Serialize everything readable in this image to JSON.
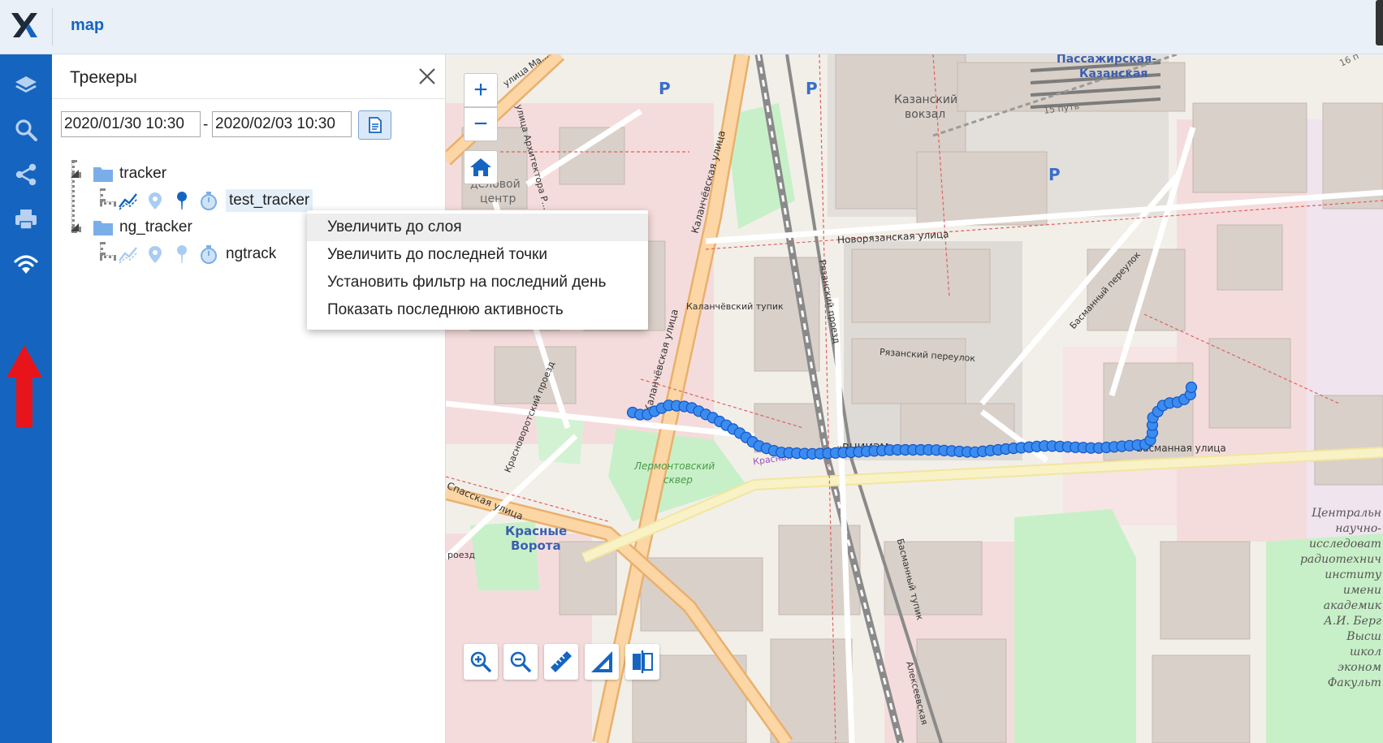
{
  "header": {
    "title": "map",
    "logo": "x-logo-icon"
  },
  "rail": {
    "items": [
      {
        "name": "layers-icon"
      },
      {
        "name": "search-icon"
      },
      {
        "name": "share-icon"
      },
      {
        "name": "print-icon"
      },
      {
        "name": "wifi-icon"
      }
    ],
    "annotation_color": "#e8141b"
  },
  "panel": {
    "title": "Трекеры",
    "date_from": "2020/01/30 10:30",
    "date_sep": "-",
    "date_to": "2020/02/03 10:30",
    "groups": [
      {
        "label": "tracker",
        "trackers": [
          {
            "label": "test_tracker",
            "selected": true
          }
        ]
      },
      {
        "label": "ng_tracker",
        "trackers": [
          {
            "label": "ngtrack",
            "selected": false
          }
        ]
      }
    ]
  },
  "context_menu": {
    "items": [
      "Увеличить до слоя",
      "Увеличить до последней точки",
      "Установить фильтр на последний день",
      "Показать последнюю активность"
    ],
    "hovered_index": 0
  },
  "map": {
    "streets": {
      "novoryazanskaya": "Новорязанская улица",
      "kalanchevskaya1": "Каланчёвская улица",
      "kalanchevskaya2": "Каланчёвская улица",
      "kalanchevsky_tupik": "Каланчёвский тупик",
      "ryazansky_proezd": "Рязанский проезд",
      "ryazansky_pereulok": "Рязанский переулок",
      "basmanny_pereulok": "Басманный переулок",
      "basmannaya": "Басманная улица",
      "krasnovorotsky": "Красноворотский проезд",
      "spasskaya": "Спасская улица",
      "basmanny_tupik": "Басманный тупик",
      "alekseevskaya": "Алексеевская",
      "arkhitektora": "улица Архитектора Р...",
      "ulitsa_ma": "улица Ма...",
      "krasnaya_frag": "Красная",
      "proezd_frag": "роезд"
    },
    "places": {
      "passazhirskaya": "Пассажирская-",
      "kazanskaya": "Казанская",
      "kazansky": "Казанский",
      "vokzal": "вокзал",
      "put15": "15 путь",
      "put16": "16 п",
      "delovoy": "деловой",
      "centr": "центр",
      "lermontovsky": "Лермонтовский",
      "skver": "сквер",
      "krasnye": "Красные",
      "vorota": "Ворота",
      "parking": "P",
      "institute": [
        "Центральн",
        "научно-",
        "исследоват",
        "радиотехнич",
        "институ",
        "имени",
        "академик",
        "А.И. Берг",
        "Высш",
        "школ",
        "эконом",
        "Факульт"
      ],
      "vniizm": "«ВНИИЗМ»"
    },
    "controls": {
      "zoom_in": "+",
      "zoom_out": "−",
      "home": "home-icon",
      "tools": [
        "zoom-in-tool-icon",
        "zoom-out-tool-icon",
        "measure-distance-icon",
        "measure-area-icon",
        "swipe-compare-icon"
      ]
    },
    "track_color": "#1e6fe8",
    "track_points_count": 80
  }
}
